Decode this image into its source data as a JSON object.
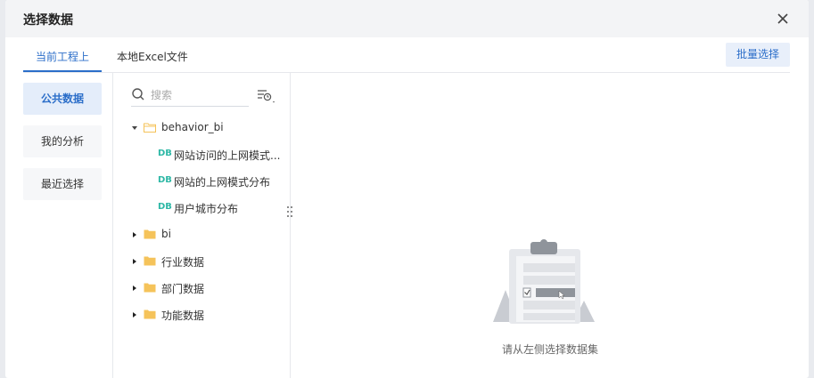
{
  "dialog": {
    "title": "选择数据"
  },
  "tabs": [
    {
      "label": "当前工程上"
    },
    {
      "label": "本地Excel文件"
    }
  ],
  "batch_button": "批量选择",
  "left_nav": [
    {
      "label": "公共数据"
    },
    {
      "label": "我的分析"
    },
    {
      "label": "最近选择"
    }
  ],
  "search": {
    "placeholder": "搜索"
  },
  "tree": {
    "root": {
      "label": "behavior_bi",
      "expanded": true
    },
    "children": [
      {
        "badge": "DB",
        "label": "网站访问的上网模式..."
      },
      {
        "badge": "DB",
        "label": "网站的上网模式分布"
      },
      {
        "badge": "DB",
        "label": "用户城市分布"
      }
    ],
    "folders": [
      {
        "label": "bi"
      },
      {
        "label": "行业数据"
      },
      {
        "label": "部门数据"
      },
      {
        "label": "功能数据"
      }
    ]
  },
  "empty_state": {
    "text": "请从左侧选择数据集"
  },
  "colors": {
    "accent": "#2b6ec9",
    "db_badge": "#2eb8a6",
    "folder": "#f5c35a"
  }
}
